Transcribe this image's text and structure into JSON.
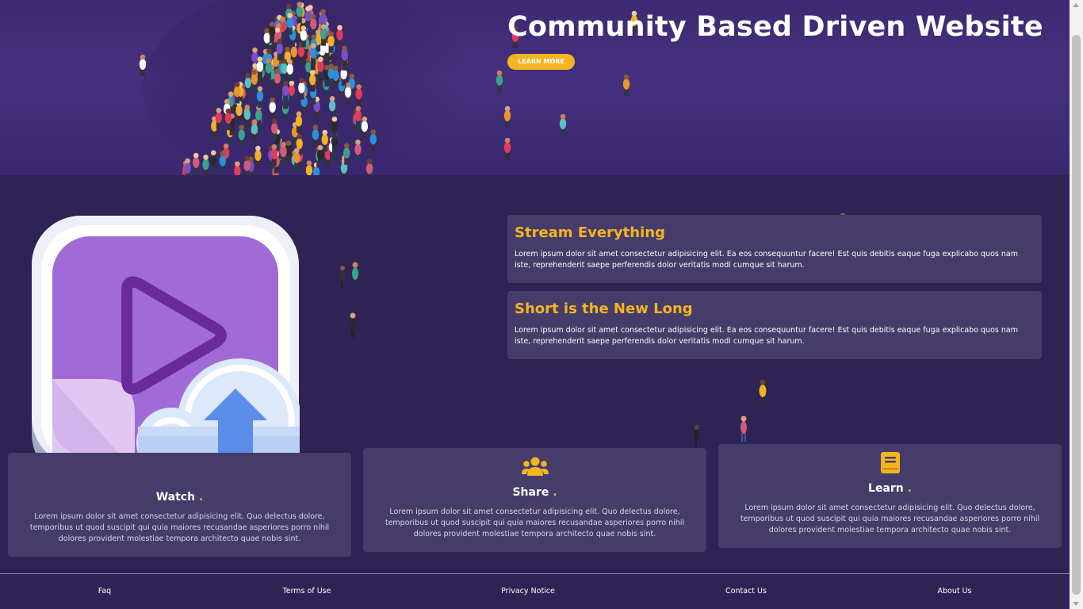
{
  "hero": {
    "title": "Community Based Driven Website",
    "button_label": "LEARN MORE"
  },
  "features": [
    {
      "title": "Stream Everything",
      "text": "Lorem ipsum dolor sit amet consectetur adipisicing elit. Ea eos consequuntur facere! Est quis debitis eaque fuga explicabo quos nam iste, reprehenderit saepe perferendis dolor veritatis modi cumque sit harum."
    },
    {
      "title": "Short is the New Long",
      "text": "Lorem ipsum dolor sit amet consectetur adipisicing elit. Ea eos consequuntur facere! Est quis debitis eaque fuga explicabo quos nam iste, reprehenderit saepe perferendis dolor veritatis modi cumque sit harum."
    }
  ],
  "cards": [
    {
      "title": "Watch",
      "icon": "video-camera-icon",
      "text": "Lorem ipsum dolor sit amet consectetur adipisicing elit. Quo delectus dolore, temporibus ut quod suscipit qui quia maiores recusandae asperiores porro nihil dolores provident molestiae tempora architecto quae nobis sint."
    },
    {
      "title": "Share",
      "icon": "users-icon",
      "text": "Lorem ipsum dolor sit amet consectetur adipisicing elit. Quo delectus dolore, temporibus ut quod suscipit qui quia maiores recusandae asperiores porro nihil dolores provident molestiae tempora architecto quae nobis sint."
    },
    {
      "title": "Learn",
      "icon": "book-icon",
      "text": "Lorem ipsum dolor sit amet consectetur adipisicing elit. Quo delectus dolore, temporibus ut quod suscipit qui quia maiores recusandae asperiores porro nihil dolores provident molestiae tempora architecto quae nobis sint."
    }
  ],
  "title_dot": ".",
  "footer": {
    "links": [
      "Faq",
      "Terms of Use",
      "Privacy Notice",
      "Contact Us",
      "About Us"
    ]
  },
  "colors": {
    "background": "#2e2354",
    "hero": "#44307e",
    "card": "#453c69",
    "accent": "#f4b521"
  },
  "illustration": {
    "icon": "video-upload-icon"
  }
}
